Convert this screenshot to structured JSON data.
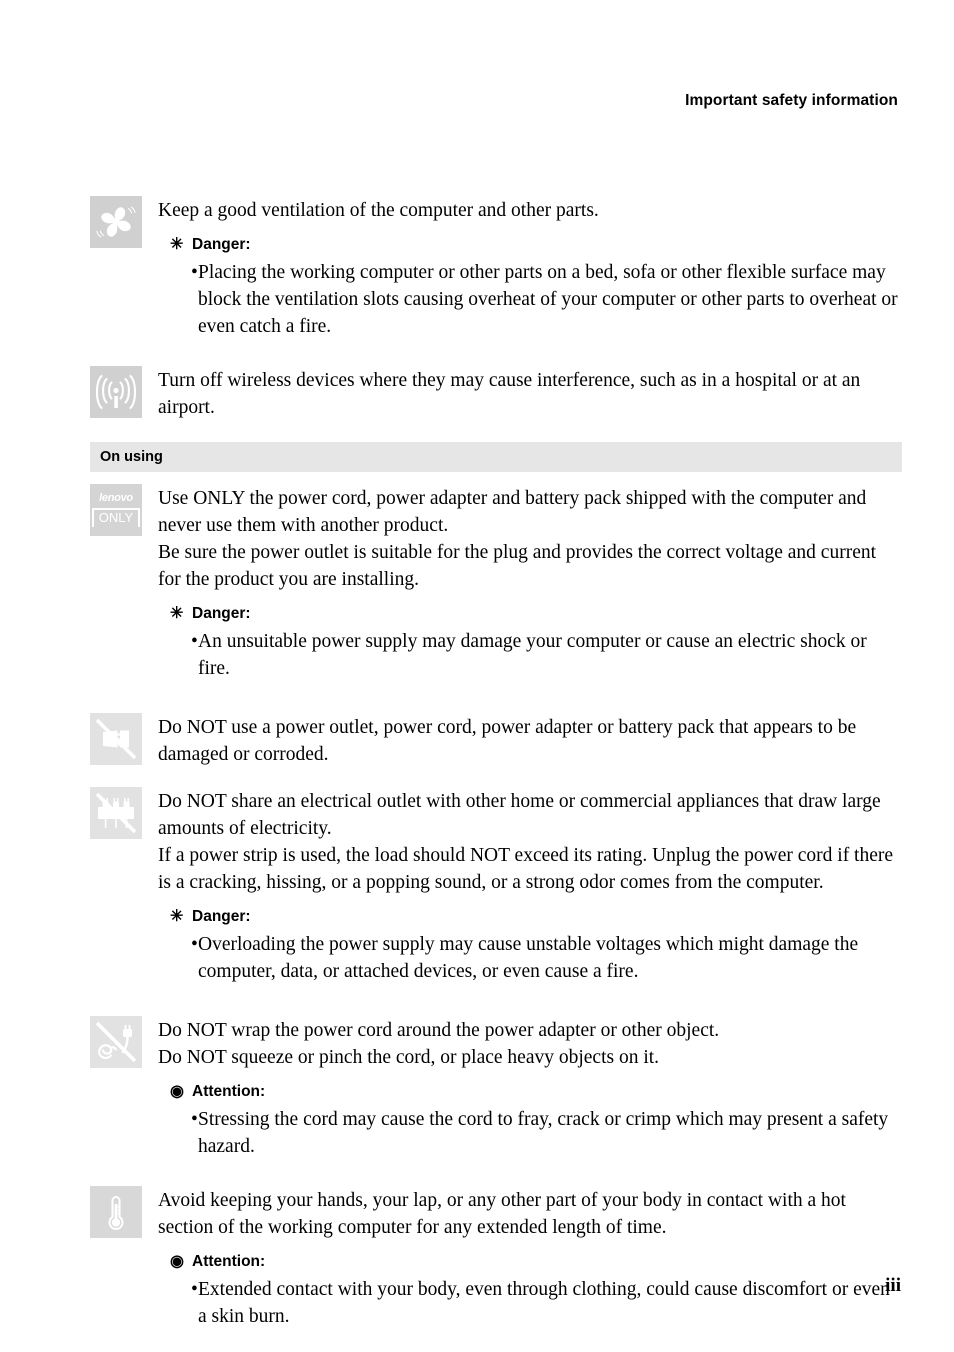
{
  "header": {
    "running_title": "Important safety information"
  },
  "footer": {
    "page_number": "iii"
  },
  "labels": {
    "danger": "Danger:",
    "attention": "Attention:",
    "danger_glyph": "✳",
    "attention_glyph": "◉",
    "bullet_glyph": "•"
  },
  "sections": [
    {
      "id": "pre-section",
      "band": null,
      "blocks": [
        {
          "icon": "fan-icon",
          "paragraphs": [
            "Keep a good ventilation of the computer and other parts."
          ],
          "callouts": [
            {
              "type": "danger",
              "items": [
                "Placing the working computer or other parts on a bed, sofa or other flexible surface may block the ventilation slots causing overheat of your computer or other parts to overheat or even catch a fire."
              ]
            }
          ]
        },
        {
          "icon": "wireless-antenna-icon",
          "paragraphs": [
            "Turn off wireless devices where they may cause interference, such as in a hospital or at an airport."
          ],
          "callouts": []
        }
      ]
    },
    {
      "id": "on-using",
      "band": "On using",
      "blocks": [
        {
          "icon": "lenovo-only-icon",
          "paragraphs": [
            "Use ONLY the power cord, power adapter and battery pack shipped with the computer and never use them with another product.",
            "Be sure the power outlet is suitable for the plug and provides the correct voltage and current for the product you are installing."
          ],
          "callouts": [
            {
              "type": "danger",
              "items": [
                "An unsuitable power supply may damage your computer or cause an electric shock or fire."
              ]
            }
          ]
        },
        {
          "icon": "damaged-outlet-icon",
          "paragraphs": [
            "Do NOT use a power outlet, power cord, power adapter or battery pack that appears to be damaged or corroded."
          ],
          "callouts": []
        },
        {
          "icon": "power-strip-icon",
          "paragraphs": [
            "Do NOT share an electrical outlet with other home or commercial appliances that draw large amounts of electricity.",
            "If a power strip is used, the load should NOT exceed its rating. Unplug the power cord if there is a cracking, hissing, or a popping sound, or a strong odor comes from the computer."
          ],
          "callouts": [
            {
              "type": "danger",
              "items": [
                "Overloading the power supply may cause unstable voltages which might damage the computer, data, or attached devices, or even cause a fire."
              ]
            }
          ]
        },
        {
          "icon": "cord-wrap-icon",
          "paragraphs": [
            "Do NOT wrap the power cord around the power adapter or other object.",
            "Do NOT squeeze or pinch the cord, or place heavy objects on it."
          ],
          "callouts": [
            {
              "type": "attention",
              "items": [
                "Stressing the cord may cause the cord to fray, crack or crimp which may present a safety hazard."
              ]
            }
          ]
        },
        {
          "icon": "thermometer-icon",
          "paragraphs": [
            "Avoid keeping your hands, your lap, or any other part of your body in contact with a hot section of the working computer for any extended length of time."
          ],
          "callouts": [
            {
              "type": "attention",
              "items": [
                "Extended contact with your body, even through clothing, could cause discomfort or even a skin burn."
              ]
            }
          ]
        }
      ]
    }
  ],
  "colors": {
    "band_background": "#e6e6e6",
    "icon_background_dark": "#d0d0d0",
    "icon_background_light": "#e2e2e2",
    "text": "#000000"
  }
}
